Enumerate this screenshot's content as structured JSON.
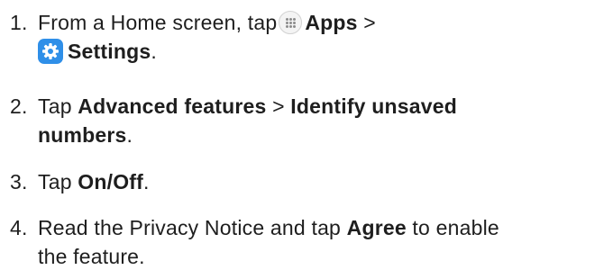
{
  "steps": [
    {
      "number": "1.",
      "line1": {
        "pre": "From a Home screen, tap",
        "bold": "Apps",
        "post": " >"
      },
      "line2": {
        "bold": "Settings",
        "post": "."
      }
    },
    {
      "number": "2.",
      "line1": {
        "pre": "Tap ",
        "bold1": "Advanced features",
        "mid": " > ",
        "bold2": "Identify unsaved"
      },
      "line2": {
        "bold": "numbers",
        "post": "."
      }
    },
    {
      "number": "3.",
      "line1": {
        "pre": "Tap ",
        "bold": "On/Off",
        "post": "."
      }
    },
    {
      "number": "4.",
      "line1": {
        "pre": "Read the Privacy Notice and tap ",
        "bold": "Agree",
        "post": " to enable"
      },
      "line2": {
        "text": "the feature."
      }
    }
  ],
  "icons": {
    "apps": "apps-icon",
    "settings": "settings-gear-icon",
    "settings_color": "#2f8fe8",
    "apps_dot_color": "#8c8c8c"
  }
}
